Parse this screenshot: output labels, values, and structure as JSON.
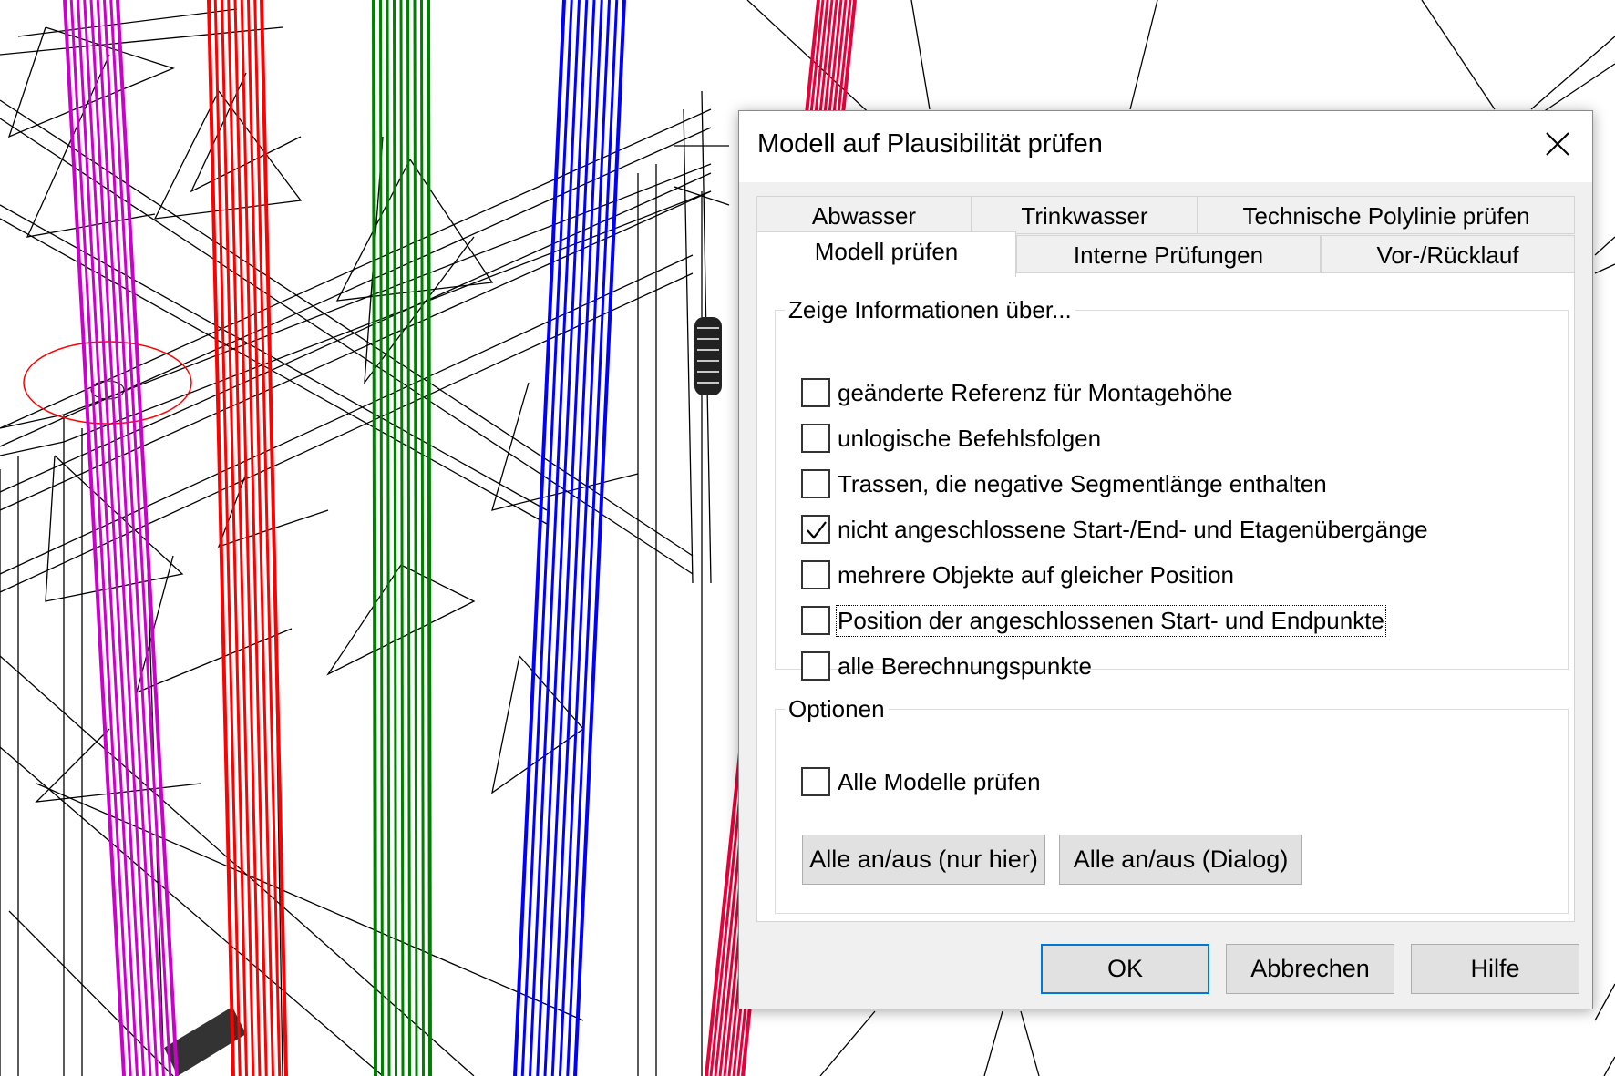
{
  "dialog": {
    "title": "Modell auf Plausibilität prüfen",
    "close_icon": "close-icon"
  },
  "tabs": {
    "row1": [
      "Abwasser",
      "Trinkwasser",
      "Technische Polylinie prüfen"
    ],
    "row2": [
      "Modell prüfen",
      "Interne Prüfungen",
      "Vor-/Rücklauf"
    ],
    "active": "Modell prüfen"
  },
  "info_group": {
    "legend": "Zeige Informationen über...",
    "options": [
      {
        "label": "geänderte Referenz für Montagehöhe",
        "checked": false
      },
      {
        "label": "unlogische Befehlsfolgen",
        "checked": false
      },
      {
        "label": "Trassen, die negative Segmentlänge enthalten",
        "checked": false
      },
      {
        "label": "nicht angeschlossene Start-/End- und Etagenübergänge",
        "checked": true
      },
      {
        "label": "mehrere Objekte auf gleicher Position",
        "checked": false
      },
      {
        "label": "Position der angeschlossenen Start- und Endpunkte",
        "checked": false,
        "focused": true
      },
      {
        "label": "alle Berechnungspunkte",
        "checked": false
      }
    ]
  },
  "options_group": {
    "legend": "Optionen",
    "all_models_label": "Alle Modelle prüfen",
    "all_models_checked": false,
    "toggle_here_label": "Alle an/aus (nur hier)",
    "toggle_dialog_label": "Alle an/aus (Dialog)"
  },
  "footer": {
    "ok_label": "OK",
    "cancel_label": "Abbrechen",
    "help_label": "Hilfe"
  },
  "colors": {
    "accent": "#0078d7",
    "pipe_magenta": "#cc00cc",
    "pipe_red": "#ff0000",
    "pipe_green": "#008000",
    "pipe_blue": "#0000ff",
    "pipe_crimson": "#e8003a"
  }
}
